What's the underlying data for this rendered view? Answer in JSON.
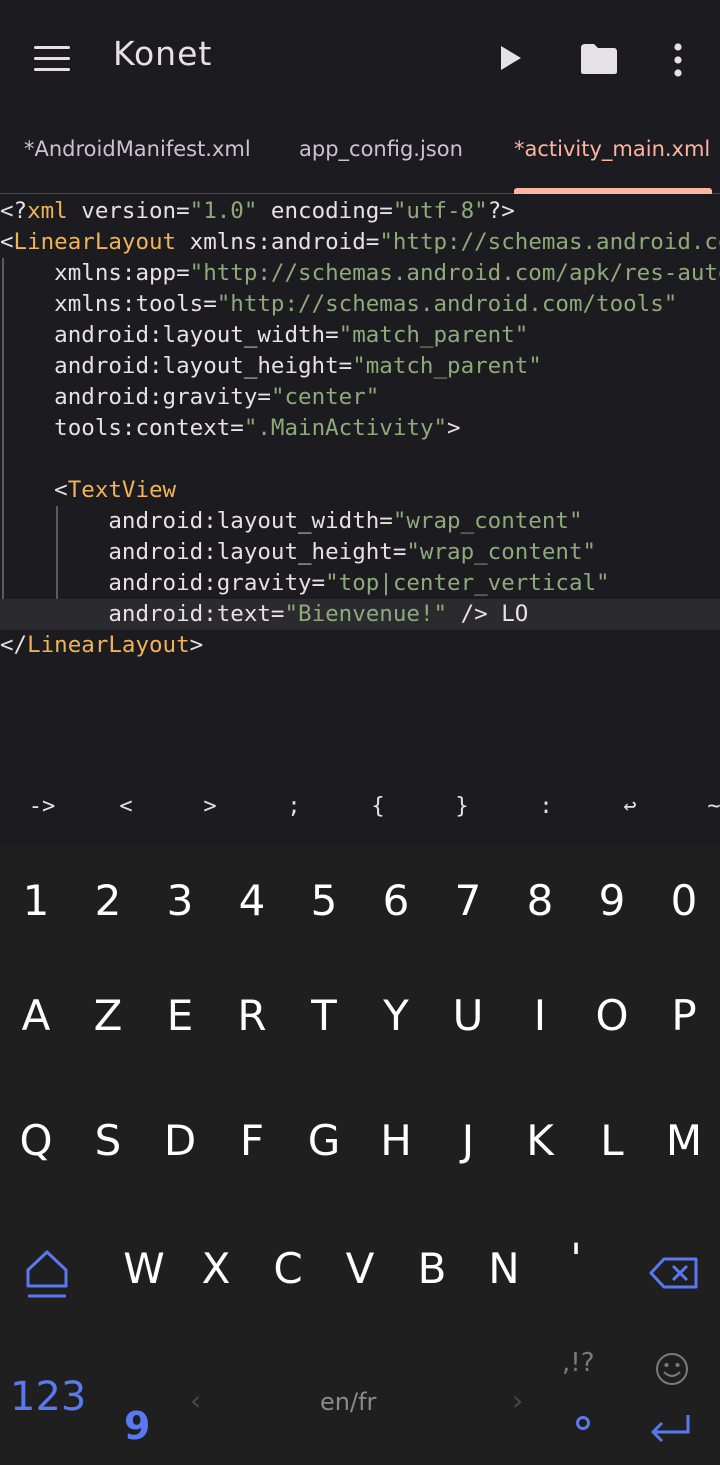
{
  "appbar": {
    "title": "Konet",
    "icons": [
      "menu-icon",
      "play-icon",
      "folder-icon",
      "more-vert-icon"
    ]
  },
  "tabs": [
    {
      "label": "*AndroidManifest.xml",
      "active": false
    },
    {
      "label": "app_config.json",
      "active": false
    },
    {
      "label": "*activity_main.xml",
      "active": true
    }
  ],
  "editor": {
    "lines": [
      [
        {
          "t": "<?",
          "c": "punct"
        },
        {
          "t": "xml",
          "c": "tag"
        },
        {
          "t": " version=",
          "c": "punct"
        },
        {
          "t": "\"1.0\"",
          "c": "str"
        },
        {
          "t": " encoding=",
          "c": "punct"
        },
        {
          "t": "\"utf-8\"",
          "c": "str"
        },
        {
          "t": "?>",
          "c": "punct"
        }
      ],
      [
        {
          "t": "<",
          "c": "punct"
        },
        {
          "t": "LinearLayout",
          "c": "tag"
        },
        {
          "t": " xmlns:android=",
          "c": "punct"
        },
        {
          "t": "\"http://schemas.android.com/apk/res/android\"",
          "c": "str"
        }
      ],
      [
        {
          "t": "    xmlns:app=",
          "c": "punct"
        },
        {
          "t": "\"http://schemas.android.com/apk/res-auto\"",
          "c": "str"
        }
      ],
      [
        {
          "t": "    xmlns:tools=",
          "c": "punct"
        },
        {
          "t": "\"http://schemas.android.com/tools\"",
          "c": "str"
        }
      ],
      [
        {
          "t": "    android:layout_width=",
          "c": "punct"
        },
        {
          "t": "\"match_parent\"",
          "c": "str"
        }
      ],
      [
        {
          "t": "    android:layout_height=",
          "c": "punct"
        },
        {
          "t": "\"match_parent\"",
          "c": "str"
        }
      ],
      [
        {
          "t": "    android:gravity=",
          "c": "punct"
        },
        {
          "t": "\"center\"",
          "c": "str"
        }
      ],
      [
        {
          "t": "    tools:context=",
          "c": "punct"
        },
        {
          "t": "\".MainActivity\"",
          "c": "str"
        },
        {
          "t": ">",
          "c": "punct"
        }
      ],
      [],
      [
        {
          "t": "    <",
          "c": "punct"
        },
        {
          "t": "TextView",
          "c": "tag"
        }
      ],
      [
        {
          "t": "        android:layout_width=",
          "c": "punct"
        },
        {
          "t": "\"wrap_content\"",
          "c": "str"
        }
      ],
      [
        {
          "t": "        android:layout_height=",
          "c": "punct"
        },
        {
          "t": "\"wrap_content\"",
          "c": "str"
        }
      ],
      [
        {
          "t": "        android:gravity=",
          "c": "punct"
        },
        {
          "t": "\"top|center_vertical\"",
          "c": "str"
        }
      ],
      [
        {
          "t": "        android:text=",
          "c": "punct"
        },
        {
          "t": "\"Bienvenue!\"",
          "c": "str"
        },
        {
          "t": " /> LO",
          "c": "punct"
        }
      ],
      [
        {
          "t": "</",
          "c": "punct"
        },
        {
          "t": "LinearLayout",
          "c": "tag"
        },
        {
          "t": ">",
          "c": "punct"
        }
      ]
    ],
    "current_line": 13,
    "colors": {
      "tag": "#f0b454",
      "str": "#8ea97a",
      "punct": "#e6e1e5"
    }
  },
  "symbol_bar": [
    "->",
    "<",
    ">",
    ";",
    "{",
    "}",
    ":",
    "↩",
    "~"
  ],
  "keyboard": {
    "row1": [
      "1",
      "2",
      "3",
      "4",
      "5",
      "6",
      "7",
      "8",
      "9",
      "0"
    ],
    "row2": [
      "A",
      "Z",
      "E",
      "R",
      "T",
      "Y",
      "U",
      "I",
      "O",
      "P"
    ],
    "row3": [
      "Q",
      "S",
      "D",
      "F",
      "G",
      "H",
      "J",
      "K",
      "L",
      "M"
    ],
    "row4": [
      "W",
      "X",
      "C",
      "V",
      "B",
      "N",
      "'"
    ],
    "numbers_key": "123",
    "suggestion": "9",
    "language": "en/fr",
    "punct_key": ",!?",
    "accent_color": "#5a79f0"
  }
}
